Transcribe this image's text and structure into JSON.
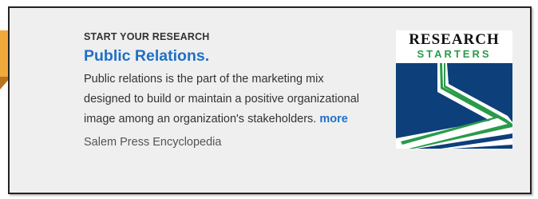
{
  "card": {
    "eyebrow": "START YOUR RESEARCH",
    "title": "Public Relations.",
    "description": "Public relations is the part of the marketing mix designed to build or maintain a positive organizational image among an organization's stakeholders.",
    "more_label": "more",
    "source": "Salem Press Encyclopedia"
  },
  "logo": {
    "line1": "RESEARCH",
    "line2": "STARTERS",
    "icon": "research-starters-logo"
  },
  "colors": {
    "title_link": "#1f6fc6",
    "card_background": "#efefef",
    "card_border": "#222222",
    "logo_navy": "#0d3f7a",
    "logo_green": "#2a9a4a",
    "corner_tab": "#f2a93b"
  }
}
